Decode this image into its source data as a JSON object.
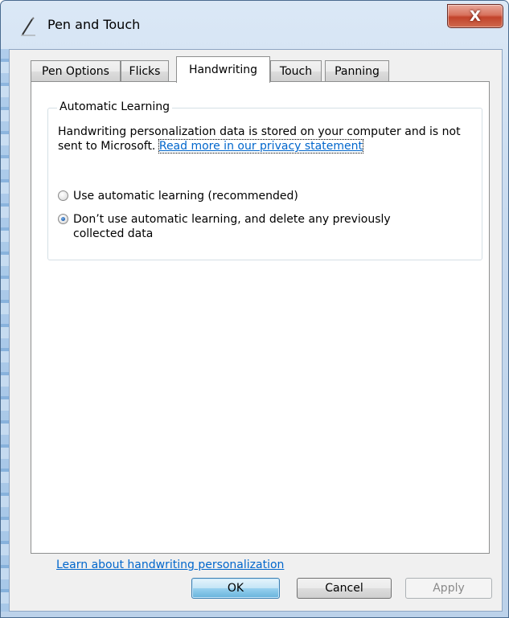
{
  "window": {
    "title": "Pen and Touch",
    "close_label": "X"
  },
  "tabs": [
    {
      "label": "Pen Options"
    },
    {
      "label": "Flicks"
    },
    {
      "label": "Handwriting"
    },
    {
      "label": "Touch"
    },
    {
      "label": "Panning"
    }
  ],
  "active_tab": "Handwriting",
  "group": {
    "title": "Automatic Learning",
    "description": "Handwriting personalization data is stored on your computer and is not sent to Microsoft.",
    "privacy_link": "Read more in our privacy statement"
  },
  "options": [
    {
      "label": "Use automatic learning (recommended)",
      "selected": false
    },
    {
      "label": "Don’t use automatic learning, and delete any previously collected data",
      "selected": true
    }
  ],
  "learn_link": "Learn about handwriting personalization",
  "buttons": {
    "ok": "OK",
    "cancel": "Cancel",
    "apply": "Apply"
  }
}
